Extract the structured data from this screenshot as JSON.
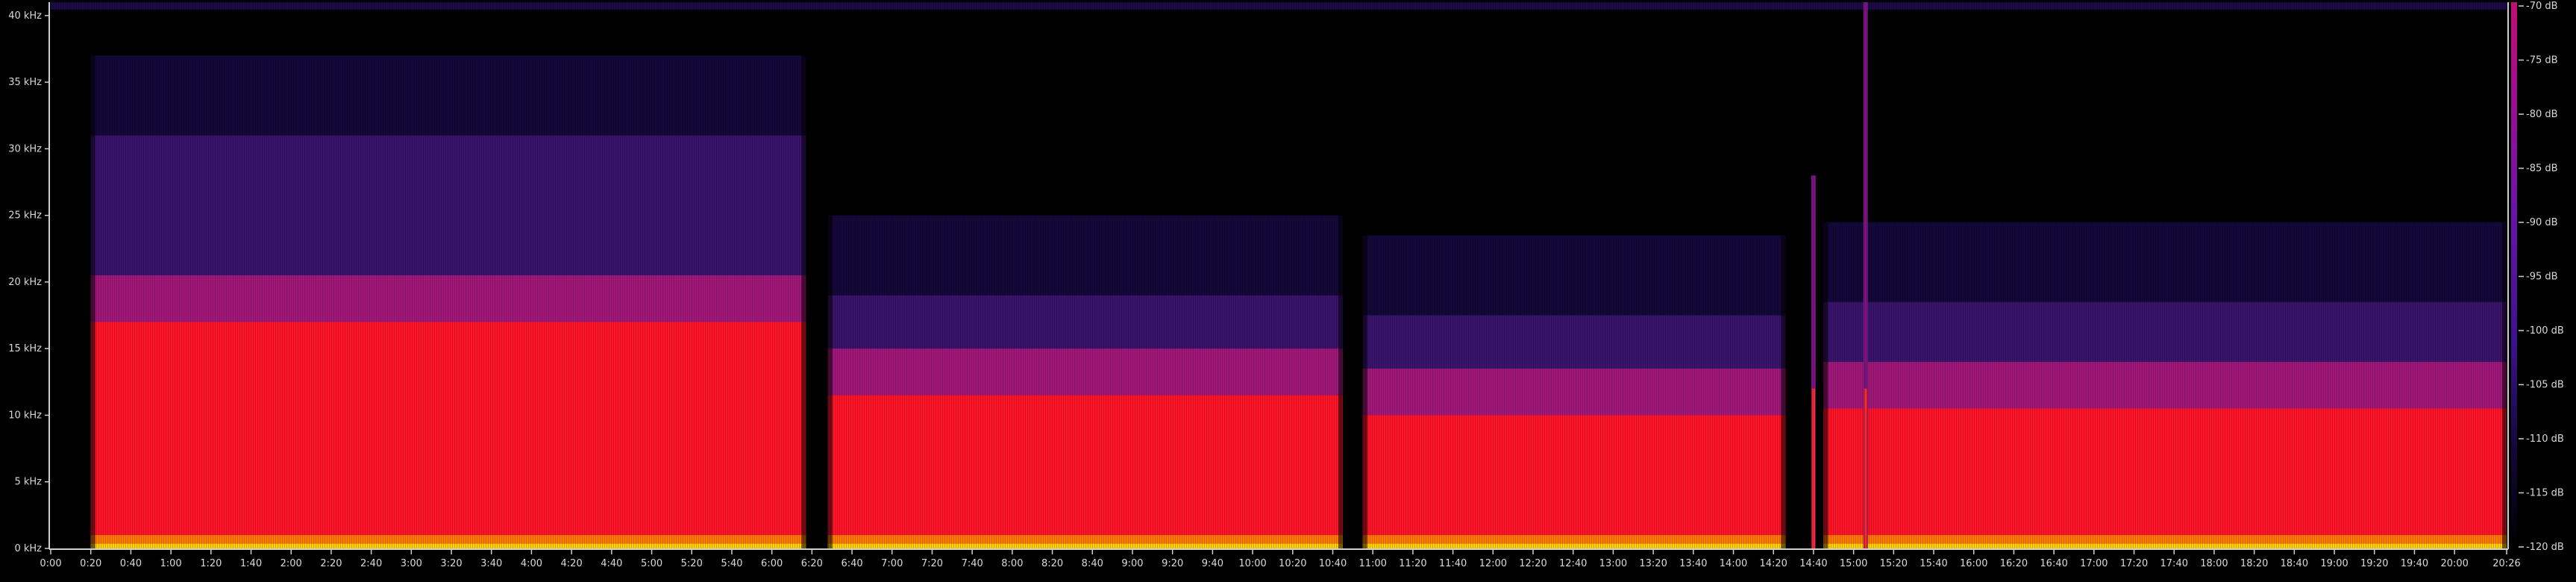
{
  "chart_data": {
    "type": "heatmap",
    "title": "",
    "xlabel": "",
    "ylabel": "",
    "x_unit": "time (m:ss)",
    "x_range": [
      "0:00",
      "20:26"
    ],
    "y_range_khz": [
      0,
      41
    ],
    "y_ticks": [
      "0 kHz",
      "5 kHz",
      "10 kHz",
      "15 kHz",
      "20 kHz",
      "25 kHz",
      "30 kHz",
      "35 kHz",
      "40 kHz"
    ],
    "y_tick_values_khz": [
      0,
      5,
      10,
      15,
      20,
      25,
      30,
      35,
      40
    ],
    "x_ticks": [
      "0:00",
      "0:20",
      "0:40",
      "1:00",
      "1:20",
      "1:40",
      "2:00",
      "2:20",
      "2:40",
      "3:00",
      "3:20",
      "3:40",
      "4:00",
      "4:20",
      "4:40",
      "5:00",
      "5:20",
      "5:40",
      "6:00",
      "6:20",
      "6:40",
      "7:00",
      "7:20",
      "7:40",
      "8:00",
      "8:20",
      "8:40",
      "9:00",
      "9:20",
      "9:40",
      "10:00",
      "10:20",
      "10:40",
      "11:00",
      "11:20",
      "11:40",
      "12:00",
      "12:20",
      "12:40",
      "13:00",
      "13:20",
      "13:40",
      "14:00",
      "14:20",
      "14:40",
      "15:00",
      "15:20",
      "15:40",
      "16:00",
      "16:20",
      "16:40",
      "17:00",
      "17:20",
      "17:40",
      "18:00",
      "18:20",
      "18:40",
      "19:00",
      "19:20",
      "19:40",
      "20:00",
      "20:26"
    ],
    "colorbar": {
      "label_ticks": [
        "-70 dB",
        "-75 dB",
        "-80 dB",
        "-85 dB",
        "-90 dB",
        "-95 dB",
        "-100 dB",
        "-105 dB",
        "-110 dB",
        "-115 dB",
        "-120 dB"
      ],
      "range_db": [
        -120,
        -70
      ],
      "colors": [
        "#000000",
        "#10083a",
        "#2a0f78",
        "#5a13a8",
        "#8a0f9a",
        "#c01060",
        "#ff1020",
        "#ff6a00",
        "#ffd200"
      ]
    },
    "grid": false,
    "colors": {
      "background": "#000000",
      "axis": "#cfcfcf",
      "text": "#d8d8d8",
      "band_red": "#ff1428",
      "band_magenta": "#a2187a",
      "band_violet": "#3a136c",
      "band_navy": "#130839",
      "floor_orange": "#ff7a00",
      "floor_yellow": "#ffd200"
    },
    "gaps_seconds": [
      {
        "start": 0,
        "end": 20
      },
      {
        "start": 377,
        "end": 388
      },
      {
        "start": 645,
        "end": 655
      },
      {
        "start": 866,
        "end": 876
      },
      {
        "start": 879,
        "end": 885
      },
      {
        "start": 1226,
        "end": 1226
      }
    ],
    "segments": [
      {
        "start": 20,
        "end": 377,
        "red_top_khz": 17.0,
        "violet_top_khz": 31.0
      },
      {
        "start": 388,
        "end": 645,
        "red_top_khz": 11.5,
        "violet_top_khz": 19.0
      },
      {
        "start": 655,
        "end": 866,
        "red_top_khz": 10.0,
        "violet_top_khz": 17.5
      },
      {
        "start": 885,
        "end": 1226,
        "red_top_khz": 10.5,
        "violet_top_khz": 18.5
      }
    ],
    "spikes_seconds": [
      {
        "at": 906,
        "height_khz": 41.0
      },
      {
        "at": 880,
        "height_khz": 28.0
      }
    ]
  }
}
